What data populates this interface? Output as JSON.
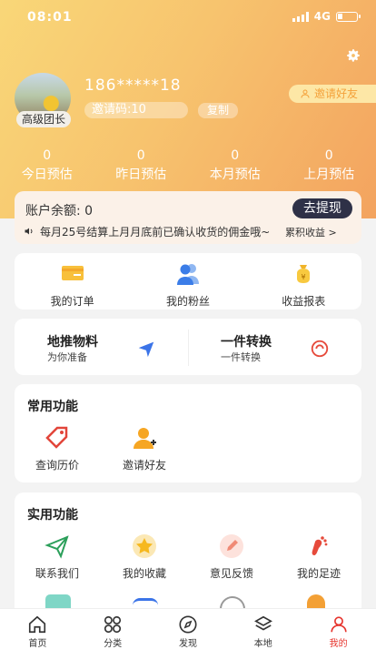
{
  "status_bar": {
    "time": "08:01",
    "network": "4G"
  },
  "profile": {
    "grade": "高级团长",
    "phone": "186*****18",
    "invite_code": "邀请码:10",
    "copy_label": "复制",
    "invite_friend_label": "邀请好友"
  },
  "stats": [
    {
      "value": "0",
      "label": "今日预估"
    },
    {
      "value": "0",
      "label": "昨日预估"
    },
    {
      "value": "0",
      "label": "本月预估"
    },
    {
      "value": "0",
      "label": "上月预估"
    }
  ],
  "balance": {
    "label": "账户余额:  0",
    "withdraw_label": "去提现",
    "notice": "每月25号结算上月月底前已确认收货的佣金哦~",
    "more_label": "累积收益 >"
  },
  "quick": [
    {
      "label": "我的订单",
      "icon": "order-card-icon"
    },
    {
      "label": "我的粉丝",
      "icon": "fans-icon"
    },
    {
      "label": "收益报表",
      "icon": "money-bag-icon"
    }
  ],
  "promo": [
    {
      "title": "地推物料",
      "sub": "为你准备",
      "icon": "send-arrow-icon"
    },
    {
      "title": "一件转换",
      "sub": "一件转换",
      "icon": "convert-icon"
    }
  ],
  "common": {
    "title": "常用功能",
    "items": [
      {
        "label": "查询历价",
        "icon": "price-tag-icon"
      },
      {
        "label": "邀请好友",
        "icon": "invite-person-icon"
      }
    ]
  },
  "utility": {
    "title": "实用功能",
    "items": [
      {
        "label": "联系我们",
        "icon": "paper-plane-icon"
      },
      {
        "label": "我的收藏",
        "icon": "star-icon"
      },
      {
        "label": "意见反馈",
        "icon": "feedback-icon"
      },
      {
        "label": "我的足迹",
        "icon": "footprint-icon"
      }
    ]
  },
  "tabs": [
    {
      "label": "首页",
      "icon": "home-icon"
    },
    {
      "label": "分类",
      "icon": "category-icon"
    },
    {
      "label": "发现",
      "icon": "compass-icon"
    },
    {
      "label": "本地",
      "icon": "layers-icon"
    },
    {
      "label": "我的",
      "icon": "user-icon",
      "active": true
    }
  ],
  "colors": {
    "accent": "#e6342d",
    "header_start": "#f9d778",
    "header_end": "#f3a35f",
    "withdraw_bg": "#2e3147"
  }
}
